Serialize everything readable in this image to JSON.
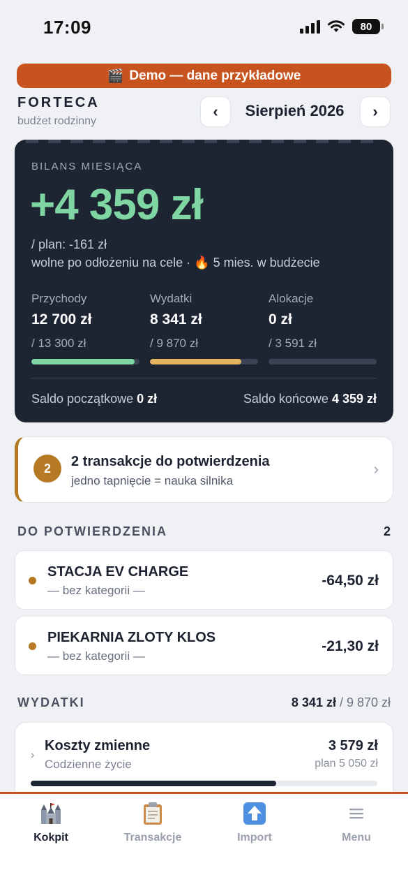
{
  "status_bar": {
    "time": "17:09",
    "battery": "80"
  },
  "demo_banner": {
    "icon": "🎬",
    "text": "Demo — dane przykładowe"
  },
  "header": {
    "app_name": "FORTECA",
    "app_subtitle": "budżet rodzinny",
    "prev_label": "‹",
    "next_label": "›",
    "month": "Sierpień 2026"
  },
  "balance": {
    "label": "BILANS MIESIĄCA",
    "amount": "+4 359 zł",
    "plan": "/ plan: -161 zł",
    "free_text": "wolne po odłożeniu na cele · ",
    "streak_icon": "🔥",
    "streak_text": " 5 mies. w budżecie",
    "columns": [
      {
        "title": "Przychody",
        "value": "12 700 zł",
        "plan": "/ 13 300 zł",
        "progress": 0.955,
        "color": "#7fd6a2"
      },
      {
        "title": "Wydatki",
        "value": "8 341 zł",
        "plan": "/ 9 870 zł",
        "progress": 0.845,
        "color": "#e4b35f"
      },
      {
        "title": "Alokacje",
        "value": "0 zł",
        "plan": "/ 3 591 zł",
        "progress": 0,
        "color": "#7fd6a2"
      }
    ],
    "saldo_start_label": "Saldo początkowe ",
    "saldo_start_value": "0 zł",
    "saldo_end_label": "Saldo końcowe ",
    "saldo_end_value": "4 359 zł"
  },
  "confirm_card": {
    "count": "2",
    "title": "2 transakcje do potwierdzenia",
    "subtitle": "jedno tapnięcie = nauka silnika",
    "chevron": "›"
  },
  "pending_section": {
    "title": "DO POTWIERDZENIA",
    "count": "2",
    "items": [
      {
        "name": "STACJA EV CHARGE",
        "category": "— bez kategorii —",
        "amount": "-64,50 zł"
      },
      {
        "name": "PIEKARNIA ZLOTY KLOS",
        "category": "— bez kategorii —",
        "amount": "-21,30 zł"
      }
    ]
  },
  "expenses_section": {
    "title": "WYDATKI",
    "spent": "8 341 zł",
    "planned": " / 9 870 zł",
    "card": {
      "chevron": "›",
      "title": "Koszty zmienne",
      "subtitle": "Codzienne życie",
      "amount": "3 579 zł",
      "plan": "plan 5 050 zł",
      "progress": 0.709
    }
  },
  "tabbar": {
    "tabs": [
      {
        "label": "Kokpit",
        "icon": "castle-icon",
        "active": true
      },
      {
        "label": "Transakcje",
        "icon": "clipboard-icon",
        "active": false
      },
      {
        "label": "Import",
        "icon": "upload-icon",
        "active": false
      },
      {
        "label": "Menu",
        "icon": "menu-icon",
        "active": false
      }
    ]
  }
}
